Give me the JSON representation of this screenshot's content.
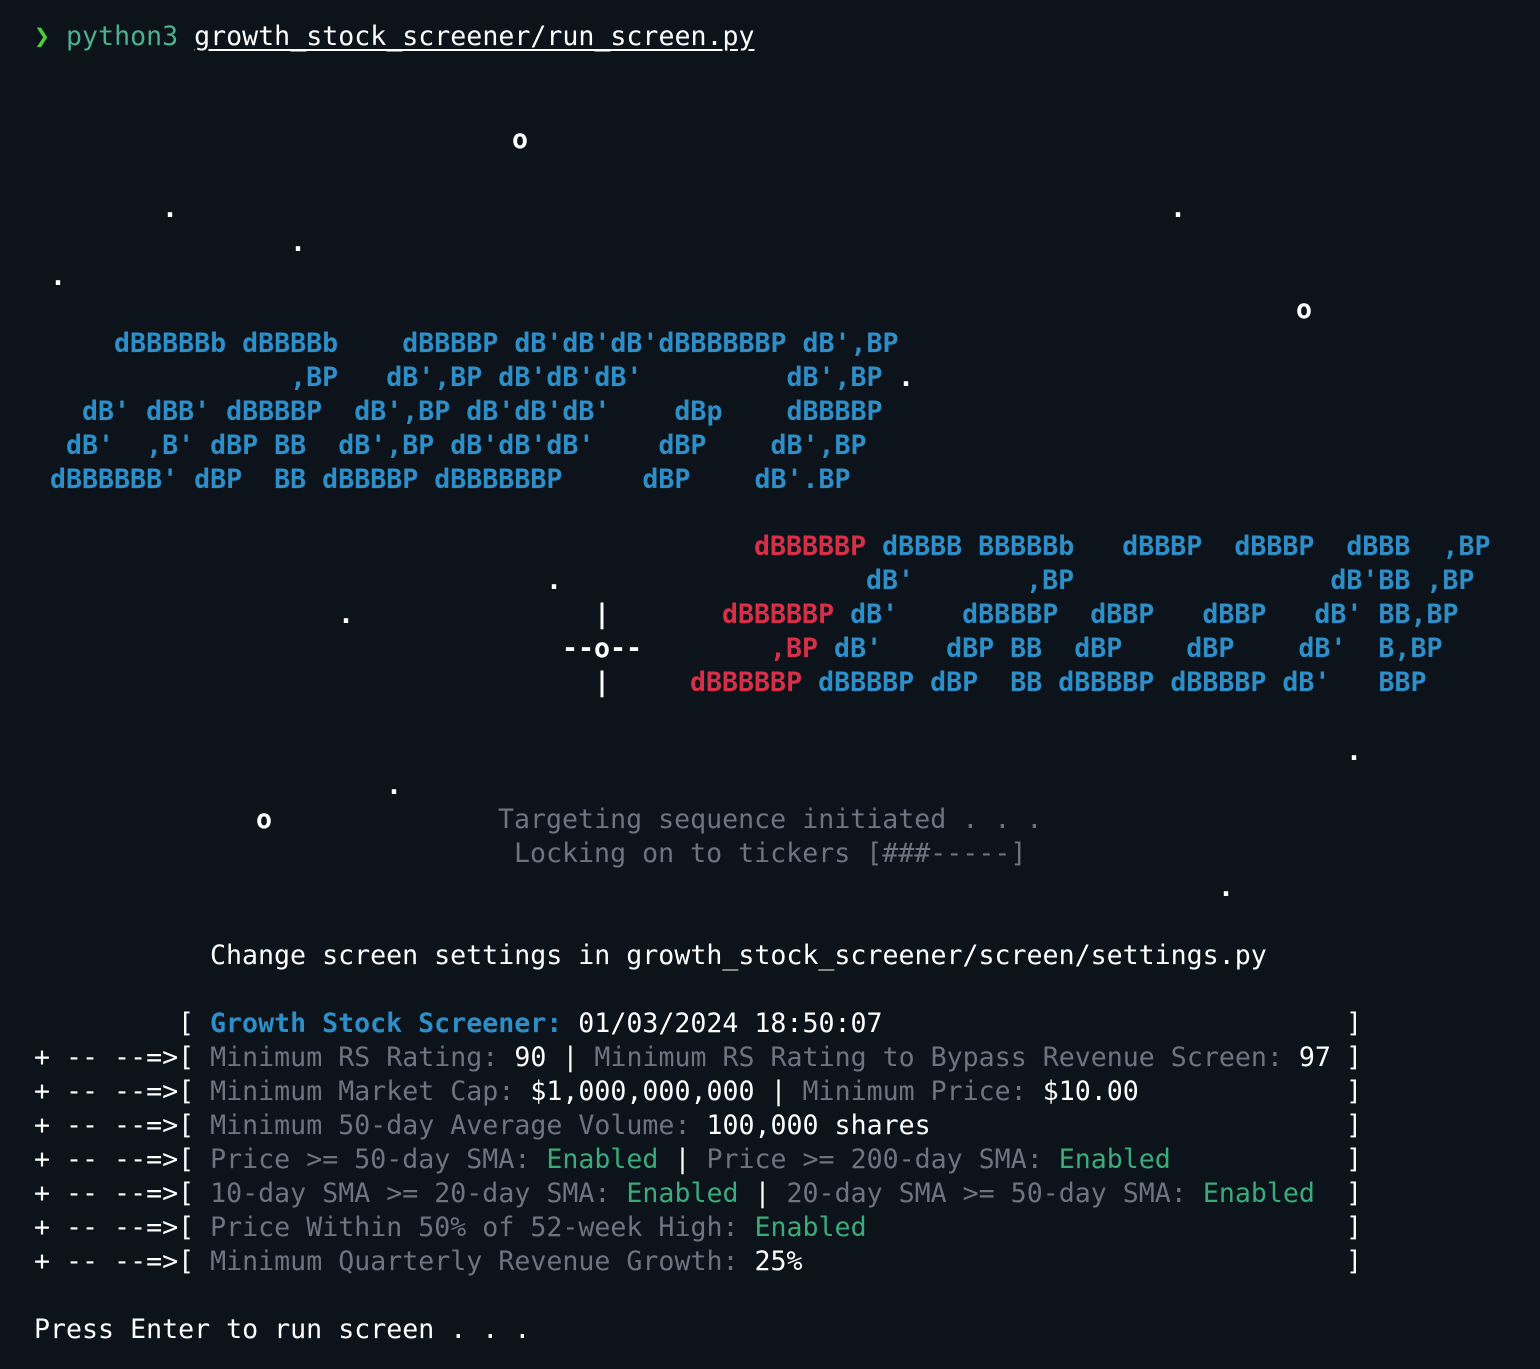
{
  "prompt": {
    "symbol": "❯",
    "command": "python3",
    "file": "growth_stock_screener/run_screen.py"
  },
  "art": {
    "stars": {
      "r3": "               o",
      "r5": "    .                                                          .",
      "r6": "        .",
      "r7": " .",
      "r8": "                                                                               o",
      "r10_dot": "."
    },
    "growth": [
      "    dBBBBBb dBBBBb    dBBBBP dB'dB'dB'dBBBBBBP dB',BP",
      "               ,BP   dB',BP dB'dB'dB'         dB',BP",
      "  dB' dBB' dBBBBP  dB',BP dB'dB'dB'    dBp    dBBBBP",
      " dB'  ,B' dBP BB  dB',BP dB'dB'dB'    dBP    dB',BP",
      "dBBBBBB' dBP  BB dBBBBP dBBBBBBP     dBP    dB'.BP"
    ],
    "screener_red": [
      "dBBBBBP",
      "dBBBBBP",
      ",BP",
      "dBBBBBP"
    ],
    "screener_blue": [
      " dBBBB BBBBBb   dBBBP  dBBBP  dBBB  ,BP",
      "dB'       ,BP                dB'BB ,BP",
      " dB'    dBBBBP  dBBP   dBBP   dB' BB,BP",
      " dB'    dBP BB  dBP    dBP    dB'  B,BP",
      " dBBBBP dBP  BB dBBBBP dBBBBP dB'   BBP"
    ],
    "crosshair": [
      "|",
      "--o--",
      "|"
    ],
    "r23_dot": ".",
    "r24_dot": ".",
    "r26_dot": "."
  },
  "status": {
    "targeting": "Targeting sequence initiated . . .",
    "locking": "Locking on to tickers [###-----]",
    "o_marker": "o"
  },
  "settings_hint": "Change screen settings in growth_stock_screener/screen/settings.py",
  "panel": {
    "prefix": "+ -- --=>",
    "title_label": "Growth Stock Screener:",
    "timestamp": "01/03/2024 18:50:07",
    "lines": [
      [
        {
          "t": "Minimum RS Rating: ",
          "c": "gray"
        },
        {
          "t": "90",
          "c": "white"
        },
        {
          "t": " | ",
          "c": "white"
        },
        {
          "t": "Minimum RS Rating to Bypass Revenue Screen: ",
          "c": "gray"
        },
        {
          "t": "97",
          "c": "white"
        }
      ],
      [
        {
          "t": "Minimum Market Cap: ",
          "c": "gray"
        },
        {
          "t": "$1,000,000,000",
          "c": "white"
        },
        {
          "t": " | ",
          "c": "white"
        },
        {
          "t": "Minimum Price: ",
          "c": "gray"
        },
        {
          "t": "$10.00",
          "c": "white"
        }
      ],
      [
        {
          "t": "Minimum 50-day Average Volume: ",
          "c": "gray"
        },
        {
          "t": "100,000 shares",
          "c": "white"
        }
      ],
      [
        {
          "t": "Price >= 50-day SMA: ",
          "c": "gray"
        },
        {
          "t": "Enabled",
          "c": "green"
        },
        {
          "t": " | ",
          "c": "white"
        },
        {
          "t": "Price >= 200-day SMA: ",
          "c": "gray"
        },
        {
          "t": "Enabled",
          "c": "green"
        }
      ],
      [
        {
          "t": "10-day SMA >= 20-day SMA: ",
          "c": "gray"
        },
        {
          "t": "Enabled",
          "c": "green"
        },
        {
          "t": " | ",
          "c": "white"
        },
        {
          "t": "20-day SMA >= 50-day SMA: ",
          "c": "gray"
        },
        {
          "t": "Enabled",
          "c": "green"
        }
      ],
      [
        {
          "t": "Price Within 50% of 52-week High: ",
          "c": "gray"
        },
        {
          "t": "Enabled",
          "c": "green"
        }
      ],
      [
        {
          "t": "Minimum Quarterly Revenue Growth: ",
          "c": "gray"
        },
        {
          "t": "25%",
          "c": "white"
        }
      ]
    ]
  },
  "footer": "Press Enter to run screen . . ."
}
